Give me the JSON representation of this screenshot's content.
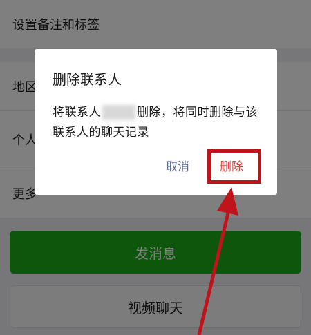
{
  "contact_page": {
    "remark_and_tags": "设置备注和标签",
    "region": "地区",
    "personal": "个人",
    "more": "更多",
    "send_message": "发消息",
    "video_call": "视频聊天"
  },
  "dialog": {
    "title": "删除联系人",
    "message_prefix": "将联系人",
    "message_suffix": "删除，将同时删除与该联系人的聊天记录",
    "cancel_label": "取消",
    "delete_label": "删除"
  },
  "colors": {
    "send_button": "#1aad19",
    "cancel_text": "#576b95",
    "delete_text": "#e64340",
    "annotation_red": "#c0141c"
  }
}
